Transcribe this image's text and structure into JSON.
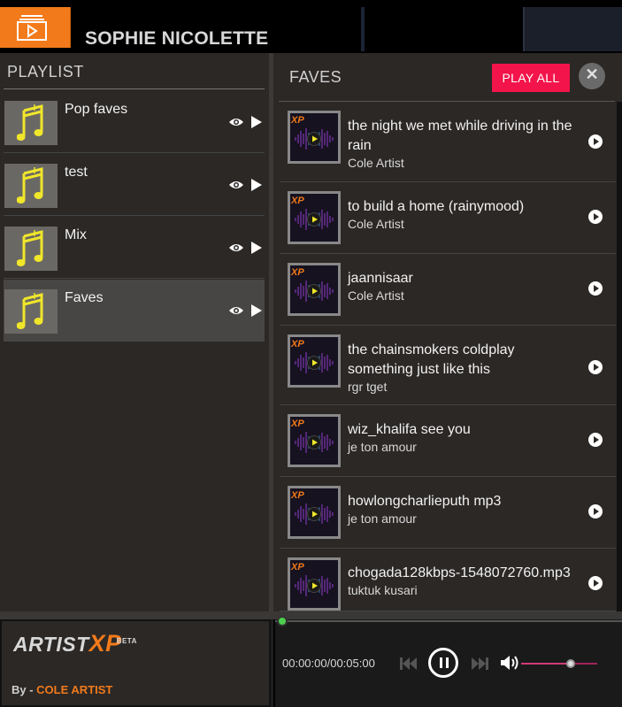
{
  "header": {
    "user_name": "SOPHIE NICOLETTE",
    "icon": "video-playlist-icon",
    "accent_color": "#f27a1a"
  },
  "playlist": {
    "heading": "PLAYLIST",
    "items": [
      {
        "label": "Pop faves",
        "icon": "music-notes-icon",
        "active": false
      },
      {
        "label": "test",
        "icon": "music-notes-icon",
        "active": false
      },
      {
        "label": "Mix",
        "icon": "music-notes-icon",
        "active": false
      },
      {
        "label": "Faves",
        "icon": "music-notes-icon",
        "active": true
      }
    ]
  },
  "faves": {
    "heading": "FAVES",
    "play_all_label": "PLAY ALL",
    "play_all_color": "#f2144a",
    "songs": [
      {
        "title": "the night we met while driving in the rain",
        "artist": "Cole Artist"
      },
      {
        "title": "to build a home (rainymood)",
        "artist": "Cole Artist"
      },
      {
        "title": "jaannisaar",
        "artist": "Cole Artist"
      },
      {
        "title": "the chainsmokers coldplay something just like this",
        "artist": "rgr tget"
      },
      {
        "title": "wiz_khalifa see you",
        "artist": "je ton amour"
      },
      {
        "title": "howlongcharlieputh mp3",
        "artist": "je ton amour"
      },
      {
        "title": "chogada128kbps-1548072760.mp3",
        "artist": "tuktuk kusari"
      }
    ]
  },
  "brand": {
    "logo_main": "ARTIST",
    "logo_accent": "XP",
    "logo_badge": "BETA",
    "by_prefix": "By - ",
    "by_name": "COLE ARTIST"
  },
  "player": {
    "time": "00:00:00/00:05:00",
    "progress": 0,
    "volume": 0.65,
    "state": "playing"
  }
}
